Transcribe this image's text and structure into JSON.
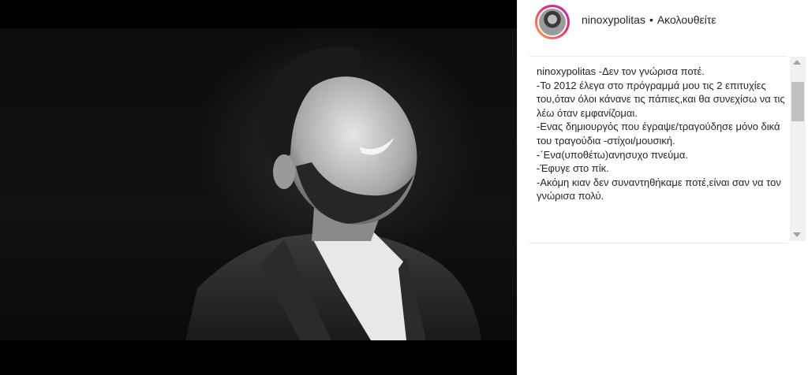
{
  "post": {
    "media": {
      "image_name": "black-and-white-portrait-photo"
    },
    "header": {
      "username": "ninoxypolitas",
      "separator": "•",
      "follow_label": "Ακολουθείτε"
    },
    "caption": {
      "username": "ninoxypolitas",
      "text": " -Δεν τον γνώρισα ποτέ.\n-Το 2012 έλεγα στο πρόγραμμά μου τις 2 επιτυχίες του,όταν όλοι κάνανε τις πάπιες,και θα συνεχίσω να τις λέω όταν εμφανίζομαι.\n-Ενας δημιουργός που έγραψε/τραγούδησε μόνο δικά του τραγούδια -στίχοι/μουσική.\n-΄Ενα(υποθέτω)ανησυχο πνεύμα.\n-Έφυγε στο πίκ.\n-Ακόμη κιαν δεν συναντηθήκαμε ποτέ,είναι σαν να τον γνώρισα πολύ."
    }
  },
  "colors": {
    "text": "#262626",
    "media_background": "#000000",
    "avatar_ring_start": "#f9a34a",
    "avatar_ring_end": "#b02fb8"
  }
}
